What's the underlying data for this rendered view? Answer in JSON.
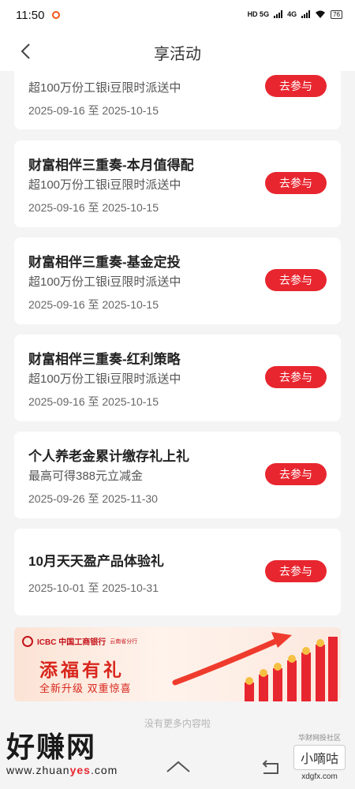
{
  "status_bar": {
    "time": "11:50",
    "network_1": "HD 5G",
    "network_2": "4G",
    "battery": "76"
  },
  "header": {
    "title": "享活动"
  },
  "activities": [
    {
      "title": "",
      "desc": "超100万份工银i豆限时派送中",
      "date": "2025-09-16 至 2025-10-15",
      "button": "去参与"
    },
    {
      "title": "财富相伴三重奏-本月值得配",
      "desc": "超100万份工银i豆限时派送中",
      "date": "2025-09-16 至 2025-10-15",
      "button": "去参与"
    },
    {
      "title": "财富相伴三重奏-基金定投",
      "desc": "超100万份工银i豆限时派送中",
      "date": "2025-09-16 至 2025-10-15",
      "button": "去参与"
    },
    {
      "title": "财富相伴三重奏-红利策略",
      "desc": "超100万份工银i豆限时派送中",
      "date": "2025-09-16 至 2025-10-15",
      "button": "去参与"
    },
    {
      "title": "个人养老金累计缴存礼上礼",
      "desc": "最高可得388元立减金",
      "date": "2025-09-26 至 2025-11-30",
      "button": "去参与"
    },
    {
      "title": "10月天天盈产品体验礼",
      "desc": "",
      "date": "2025-10-01 至 2025-10-31",
      "button": "去参与"
    }
  ],
  "banner": {
    "logo_text": "ICBC 中国工商银行",
    "region": "云南省分行",
    "title": "添福有礼",
    "subtitle": "全新升级  双重惊喜",
    "accent_color": "#d8261d"
  },
  "footer": {
    "end_text": "没有更多内容啦"
  },
  "watermarks": {
    "left_big": "好赚网",
    "left_url_prefix": "www.zhuan",
    "left_url_accent": "yes",
    "left_url_suffix": ".com",
    "right_small": "华财网投社区",
    "right_box": "小嘀咕",
    "right_domain": "xdgfx.com"
  },
  "colors": {
    "primary_button": "#e8262f",
    "background": "#f4f4f5"
  }
}
